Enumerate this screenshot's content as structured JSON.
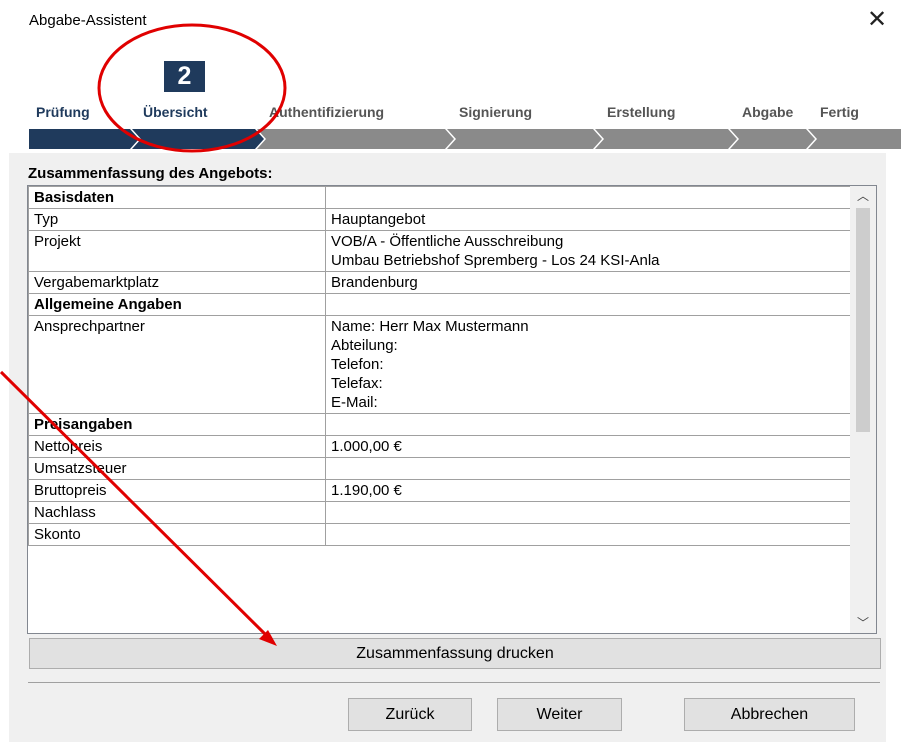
{
  "window": {
    "title": "Abgabe-Assistent",
    "close_glyph": "✕"
  },
  "wizard": {
    "current_step_number": "2",
    "steps": [
      {
        "label": "Prüfung",
        "state": "done"
      },
      {
        "label": "Übersicht",
        "state": "current"
      },
      {
        "label": "Authentifizierung",
        "state": "pending"
      },
      {
        "label": "Signierung",
        "state": "pending"
      },
      {
        "label": "Erstellung",
        "state": "pending"
      },
      {
        "label": "Abgabe",
        "state": "pending"
      },
      {
        "label": "Fertig",
        "state": "pending"
      }
    ],
    "colors": {
      "active": "#1f3a5c",
      "inactive": "#808080"
    }
  },
  "summary": {
    "label": "Zusammenfassung des Angebots:",
    "rows": [
      {
        "key": "Basisdaten",
        "value": "",
        "section": true
      },
      {
        "key": "Typ",
        "value": "Hauptangebot"
      },
      {
        "key": "Projekt",
        "value": "VOB/A - Öffentliche Ausschreibung",
        "value2": "Umbau Betriebshof Spremberg - Los 24 KSI-Anla"
      },
      {
        "key": "Vergabemarktplatz",
        "value": "Brandenburg"
      },
      {
        "key": "Allgemeine Angaben",
        "value": "",
        "section": true
      },
      {
        "key": "Ansprechpartner",
        "lines": [
          "Name:  Herr Max Mustermann",
          "Abteilung:",
          "Telefon:",
          "Telefax:",
          "E-Mail:"
        ]
      },
      {
        "key": "Preisangaben",
        "value": "",
        "section": true
      },
      {
        "key": "Nettopreis",
        "value": "1.000,00 €"
      },
      {
        "key": "Umsatzsteuer",
        "value": ""
      },
      {
        "key": "Bruttopreis",
        "value": "1.190,00 €"
      },
      {
        "key": "Nachlass",
        "value": ""
      },
      {
        "key": "Skonto",
        "value": ""
      }
    ]
  },
  "scrollbar": {
    "up_glyph": "︿",
    "down_glyph": "﹀"
  },
  "buttons": {
    "print": "Zusammenfassung drucken",
    "back": "Zurück",
    "next": "Weiter",
    "cancel": "Abbrechen"
  },
  "annotation_color": "#e00000"
}
